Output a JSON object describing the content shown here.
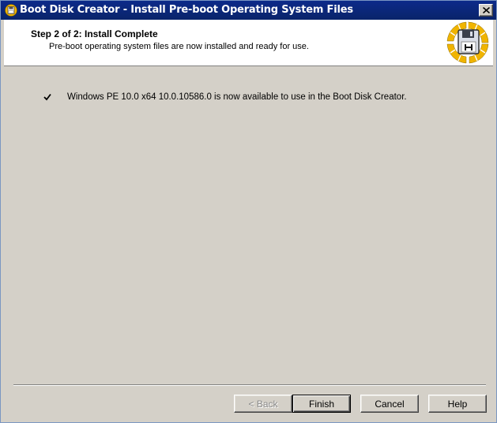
{
  "window": {
    "title": "Boot Disk Creator - Install Pre-boot Operating System Files",
    "close_icon": "close-icon"
  },
  "header": {
    "step_title": "Step 2 of 2: Install Complete",
    "step_subtitle": "Pre-boot operating system files are now installed and ready for use.",
    "logo_icon": "floppy-disk-logo-icon"
  },
  "content": {
    "status_icon": "checkmark-icon",
    "status_message": "Windows PE 10.0 x64 10.0.10586.0 is now available to use in the Boot Disk Creator."
  },
  "buttons": {
    "back": "< Back",
    "finish": "Finish",
    "cancel": "Cancel",
    "help": "Help"
  },
  "colors": {
    "titlebar": "#0a246a",
    "dialog_bg": "#d4d0c8",
    "header_bg": "#ffffff",
    "logo_yellow": "#f0b400"
  }
}
